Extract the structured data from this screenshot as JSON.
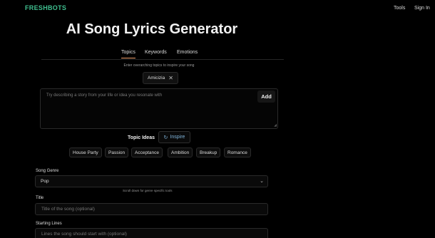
{
  "colors": {
    "brand": "#3fbf8f",
    "accent_underline": "#f2a06c",
    "inspire": "#7fb3d9",
    "background": "#000000"
  },
  "nav": {
    "brand": "FRESHBOTS",
    "links": [
      "Tools",
      "Sign In"
    ]
  },
  "page": {
    "title": "AI Song Lyrics Generator"
  },
  "tabs": {
    "items": [
      "Topics",
      "Keywords",
      "Emotions"
    ],
    "active": "Topics"
  },
  "topics": {
    "hint": "Enter overarching topics to inspire your song",
    "chips": [
      {
        "label": "Amicizia",
        "icon": "close-icon"
      }
    ],
    "textarea_placeholder": "Try describing a story from your life or idea you resonate with",
    "add_label": "Add"
  },
  "ideas": {
    "label": "Topic Ideas",
    "inspire_label": "Inspire",
    "inspire_icon": "refresh-icon",
    "items": [
      "House Party",
      "Passion",
      "Acceptance",
      "Ambition",
      "Breakup",
      "Romance"
    ]
  },
  "form": {
    "genre": {
      "label": "Song Genre",
      "value": "Pop",
      "hint": "Scroll down for genre specific tools"
    },
    "title": {
      "label": "Title",
      "placeholder": "Title of the song (optional)"
    },
    "starting": {
      "label": "Starting Lines",
      "placeholder": "Lines the song should start with (optional)"
    }
  }
}
